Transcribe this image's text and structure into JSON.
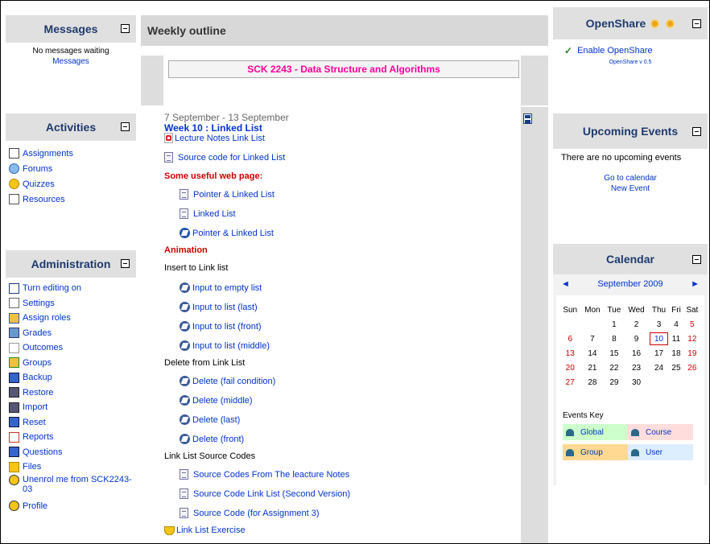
{
  "messages": {
    "title": "Messages",
    "text": "No messages waiting",
    "link": "Messages"
  },
  "activities": {
    "title": "Activities",
    "items": [
      {
        "label": "Assignments",
        "icon": "assignment-icon"
      },
      {
        "label": "Forums",
        "icon": "forum-icon"
      },
      {
        "label": "Quizzes",
        "icon": "quiz-icon"
      },
      {
        "label": "Resources",
        "icon": "resource-icon"
      }
    ]
  },
  "administration": {
    "title": "Administration",
    "items": [
      {
        "label": "Turn editing on",
        "icon": "pencil-icon"
      },
      {
        "label": "Settings",
        "icon": "settings-icon"
      },
      {
        "label": "Assign roles",
        "icon": "roles-icon"
      },
      {
        "label": "Grades",
        "icon": "grades-icon"
      },
      {
        "label": "Outcomes",
        "icon": "outcomes-icon"
      },
      {
        "label": "Groups",
        "icon": "groups-icon"
      },
      {
        "label": "Backup",
        "icon": "backup-icon"
      },
      {
        "label": "Restore",
        "icon": "restore-icon"
      },
      {
        "label": "Import",
        "icon": "import-icon"
      },
      {
        "label": "Reset",
        "icon": "reset-icon"
      },
      {
        "label": "Reports",
        "icon": "reports-icon"
      },
      {
        "label": "Questions",
        "icon": "questions-icon"
      },
      {
        "label": "Files",
        "icon": "folder-icon"
      },
      {
        "label": "Unenrol me from SCK2243-03",
        "icon": "user-icon"
      },
      {
        "label": "Profile",
        "icon": "user-icon"
      }
    ]
  },
  "outline": {
    "title": "Weekly outline",
    "course_title": "SCK 2243 - Data Structure and Algorithms",
    "week_dates": "7 September - 13 September",
    "week_title": "Week 10 : Linked List",
    "items": [
      {
        "label": "Lecture Notes Link List",
        "icon": "pdf-icon"
      },
      {
        "label": "Source code for Linked List",
        "icon": "document-icon"
      },
      {
        "label": "Some useful web page:",
        "type": "heading"
      },
      {
        "label": "Pointer & Linked List",
        "icon": "document-icon"
      },
      {
        "label": "Linked List",
        "icon": "document-icon"
      },
      {
        "label": "Pointer & Linked List",
        "icon": "web-link-icon"
      },
      {
        "label": "Animation",
        "type": "heading"
      },
      {
        "label": "Insert to Link list",
        "type": "text"
      },
      {
        "label": "Input to empty list",
        "icon": "flash-icon"
      },
      {
        "label": "Input to list (last)",
        "icon": "flash-icon"
      },
      {
        "label": "Input to list (front)",
        "icon": "flash-icon"
      },
      {
        "label": "Input to list (middle)",
        "icon": "flash-icon"
      },
      {
        "label": "Delete from Link List",
        "type": "text"
      },
      {
        "label": "Delete (fail condition)",
        "icon": "flash-icon"
      },
      {
        "label": "Delete (middle)",
        "icon": "flash-icon"
      },
      {
        "label": "Delete (last)",
        "icon": "flash-icon"
      },
      {
        "label": "Delete (front)",
        "icon": "flash-icon"
      },
      {
        "label": "Link List Source Codes",
        "type": "text"
      },
      {
        "label": "Source Codes From The leacture Notes",
        "icon": "document-icon"
      },
      {
        "label": "Source Code Link List (Second Version)",
        "icon": "document-icon"
      },
      {
        "label": "Source Code (for Assignment 3)",
        "icon": "document-icon"
      },
      {
        "label": "Link List Exercise",
        "icon": "quiz-icon"
      }
    ]
  },
  "openshare": {
    "title": "OpenShare",
    "link": "Enable OpenShare",
    "version": "OpenShare v 0.5"
  },
  "events": {
    "title": "Upcoming Events",
    "text": "There are no upcoming events",
    "links": [
      "Go to calendar",
      "New Event"
    ]
  },
  "calendar": {
    "title": "Calendar",
    "month": "September 2009",
    "days": [
      "Sun",
      "Mon",
      "Tue",
      "Wed",
      "Thu",
      "Fri",
      "Sat"
    ],
    "weeks": [
      [
        "",
        "",
        "1",
        "2",
        "3",
        "4",
        "5"
      ],
      [
        "6",
        "7",
        "8",
        "9",
        "10",
        "11",
        "12"
      ],
      [
        "13",
        "14",
        "15",
        "16",
        "17",
        "18",
        "19"
      ],
      [
        "20",
        "21",
        "22",
        "23",
        "24",
        "25",
        "26"
      ],
      [
        "27",
        "28",
        "29",
        "30",
        "",
        "",
        ""
      ]
    ],
    "today": "10",
    "key_title": "Events Key",
    "keys": [
      "Global",
      "Course",
      "Group",
      "User"
    ]
  },
  "colors": {
    "link": "#0033cc",
    "course_title": "#ff0099",
    "heading": "#cc0000",
    "week": "#0033cc",
    "block_title": "#1f3a6d",
    "weekend": "#cc0000",
    "today_border": "#cc0000",
    "global_key": "#ccffcc",
    "course_key": "#ffdddd",
    "group_key": "#ffd991",
    "user_key": "#dceeff"
  }
}
